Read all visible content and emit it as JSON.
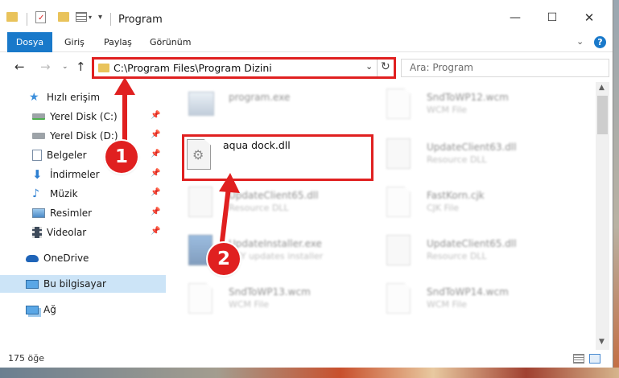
{
  "window": {
    "title": "Program",
    "controls": {
      "minimize": "—",
      "maximize": "☐",
      "close": "✕"
    }
  },
  "ribbon": {
    "tabs": [
      {
        "label": "Dosya",
        "active": true
      },
      {
        "label": "Giriş"
      },
      {
        "label": "Paylaş"
      },
      {
        "label": "Görünüm"
      }
    ],
    "help": "?"
  },
  "address": {
    "path": "C:\\Program Files\\Program Dizini",
    "search_placeholder": "Ara: Program"
  },
  "sidebar": {
    "items": [
      {
        "label": "Hızlı erişim",
        "icon": "star-icon"
      },
      {
        "label": "Yerel Disk (C:)",
        "icon": "drive-icon",
        "pinned": true
      },
      {
        "label": "Yerel Disk (D:)",
        "icon": "drive-icon",
        "pinned": true
      },
      {
        "label": "Belgeler",
        "icon": "documents-icon",
        "pinned": true
      },
      {
        "label": "İndirmeler",
        "icon": "download-icon",
        "pinned": true
      },
      {
        "label": "Müzik",
        "icon": "music-icon",
        "pinned": true
      },
      {
        "label": "Resimler",
        "icon": "pictures-icon",
        "pinned": true
      },
      {
        "label": "Videolar",
        "icon": "video-icon",
        "pinned": true
      },
      {
        "label": "OneDrive",
        "icon": "cloud-icon"
      },
      {
        "label": "Bu bilgisayar",
        "icon": "computer-icon",
        "selected": true
      },
      {
        "label": "Ağ",
        "icon": "network-icon"
      }
    ]
  },
  "files": {
    "left": [
      {
        "name": "program.exe",
        "type": ""
      },
      {
        "name": "aqua dock.dll",
        "type": "",
        "highlighted": true
      },
      {
        "name": "UpdateClient65.dll",
        "type": "Resource DLL"
      },
      {
        "name": "UpdateInstaller.exe",
        "type": "UKY updates installer"
      },
      {
        "name": "SndToWP13.wcm",
        "type": "WCM File"
      }
    ],
    "right": [
      {
        "name": "SndToWP12.wcm",
        "type": "WCM File"
      },
      {
        "name": "UpdateClient63.dll",
        "type": "Resource DLL"
      },
      {
        "name": "FastKorn.cjk",
        "type": "CJK File"
      },
      {
        "name": "UpdateClient65.dll",
        "type": "Resource DLL"
      },
      {
        "name": "SndToWP14.wcm",
        "type": "WCM File"
      }
    ]
  },
  "status": {
    "count": "175 öğe"
  },
  "annotations": {
    "step1": "1",
    "step2": "2"
  },
  "colors": {
    "accent": "#1979ca",
    "annotation": "#e02020",
    "selected": "#cce4f7"
  }
}
